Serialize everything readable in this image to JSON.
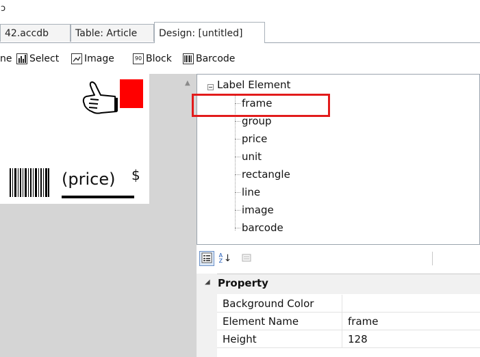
{
  "corner_glyph": "ɔ",
  "tabs": [
    {
      "label": "42.accdb"
    },
    {
      "label": "Table: Article"
    },
    {
      "label": "Design: [untitled]",
      "active": true
    }
  ],
  "toolbar": {
    "items": [
      {
        "label": "ne",
        "icon": "line-icon"
      },
      {
        "label": "Select",
        "icon": "select-icon"
      },
      {
        "label": "Image",
        "icon": "image-icon"
      },
      {
        "label": "Block",
        "icon": "block-icon",
        "icon_text": "90"
      },
      {
        "label": "Barcode",
        "icon": "barcode-icon"
      }
    ]
  },
  "canvas": {
    "price_text": "(price)",
    "currency_text": "$",
    "accent_color": "#ff0000"
  },
  "tree": {
    "root": "Label Element",
    "items": [
      "frame",
      "group",
      "price",
      "unit",
      "rectangle",
      "line",
      "image",
      "barcode"
    ],
    "highlighted": "frame",
    "highlight_color": "#e21b1b"
  },
  "property_toolbar": {
    "buttons": [
      "categorized-icon",
      "alphabetical-icon",
      "property-pages-icon"
    ],
    "sort_label": "AZ"
  },
  "properties": {
    "category": "Property",
    "rows": [
      {
        "name": "Background Color",
        "value": ""
      },
      {
        "name": "Element Name",
        "value": "frame"
      },
      {
        "name": "Height",
        "value": "128"
      }
    ]
  }
}
